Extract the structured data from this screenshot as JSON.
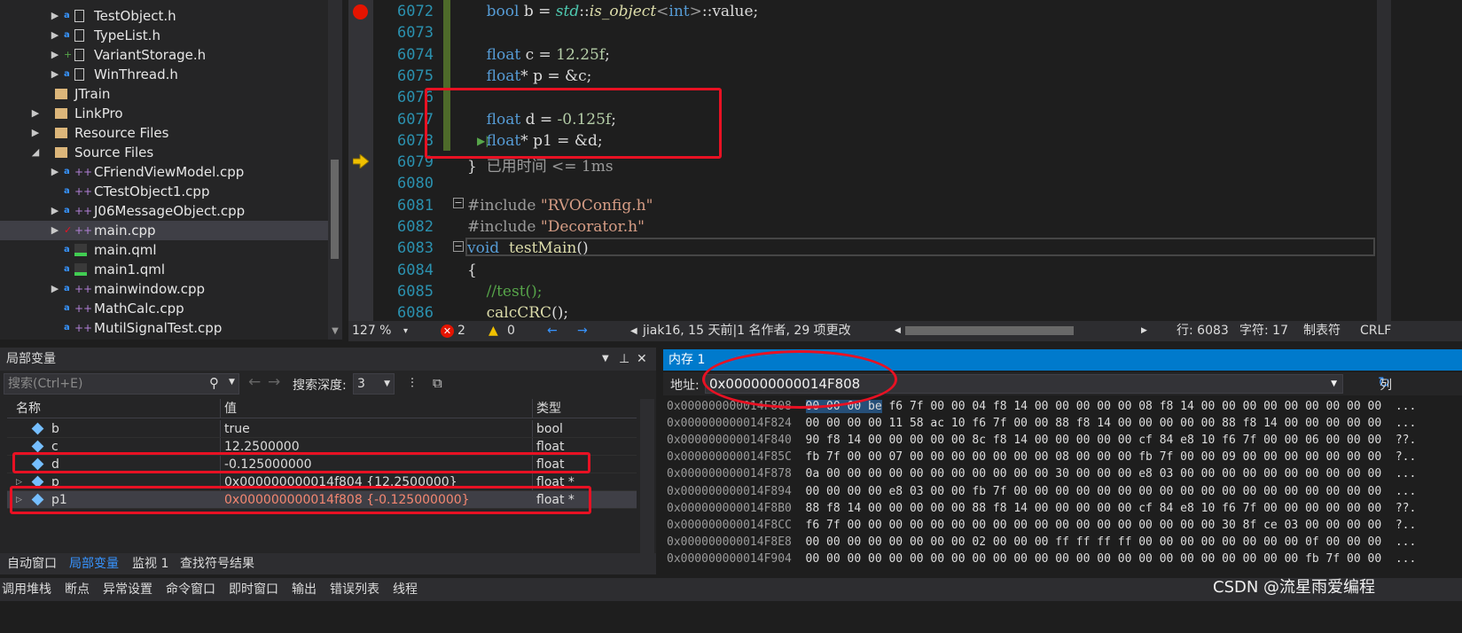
{
  "solution_explorer": {
    "items": [
      {
        "label": "TestObject.h",
        "exp": "▶",
        "status": "lock",
        "icon": "h-file-icon",
        "indent": 2
      },
      {
        "label": "TypeList.h",
        "exp": "▶",
        "status": "lock",
        "icon": "h-file-icon",
        "indent": 2
      },
      {
        "label": "VariantStorage.h",
        "exp": "▶",
        "status": "plus",
        "icon": "h-file-icon",
        "indent": 2
      },
      {
        "label": "WinThread.h",
        "exp": "▶",
        "status": "lock",
        "icon": "h-file-icon",
        "indent": 2
      },
      {
        "label": "JTrain",
        "exp": "",
        "status": "",
        "icon": "filter-folder-icon",
        "indent": 1
      },
      {
        "label": "LinkPro",
        "exp": "▶",
        "status": "",
        "icon": "filter-folder-icon",
        "indent": 1
      },
      {
        "label": "Resource Files",
        "exp": "▶",
        "status": "",
        "icon": "filter-folder-icon",
        "indent": 1
      },
      {
        "label": "Source Files",
        "exp": "◢",
        "status": "",
        "icon": "filter-folder-icon",
        "indent": 1
      },
      {
        "label": "CFriendViewModel.cpp",
        "exp": "▶",
        "status": "lock",
        "icon": "cpp-file-icon",
        "indent": 2
      },
      {
        "label": "CTestObject1.cpp",
        "exp": "",
        "status": "lock",
        "icon": "cpp-file-icon",
        "indent": 2
      },
      {
        "label": "J06MessageObject.cpp",
        "exp": "▶",
        "status": "lock",
        "icon": "cpp-file-icon",
        "indent": 2
      },
      {
        "label": "main.cpp",
        "exp": "▶",
        "status": "check",
        "icon": "cpp-file-icon",
        "indent": 2,
        "selected": true
      },
      {
        "label": "main.qml",
        "exp": "",
        "status": "lock",
        "icon": "qml-file-icon",
        "indent": 2
      },
      {
        "label": "main1.qml",
        "exp": "",
        "status": "lock",
        "icon": "qml-file-icon",
        "indent": 2
      },
      {
        "label": "mainwindow.cpp",
        "exp": "▶",
        "status": "lock",
        "icon": "cpp-file-icon",
        "indent": 2
      },
      {
        "label": "MathCalc.cpp",
        "exp": "",
        "status": "lock",
        "icon": "cpp-file-icon",
        "indent": 2
      },
      {
        "label": "MutilSignalTest.cpp",
        "exp": "",
        "status": "lock",
        "icon": "cpp-file-icon",
        "indent": 2
      }
    ]
  },
  "editor": {
    "lines": [
      {
        "n": "6072",
        "code": [
          [
            "id",
            "    "
          ],
          [
            "kw",
            "bool"
          ],
          [
            "id",
            " b = "
          ],
          [
            "ty it",
            "std"
          ],
          [
            "id",
            "::"
          ],
          [
            "fn it",
            "is_object"
          ],
          [
            "pp",
            "<"
          ],
          [
            "kw",
            "int"
          ],
          [
            "pp",
            ">"
          ],
          [
            "id",
            "::value;"
          ]
        ]
      },
      {
        "n": "6073",
        "code": []
      },
      {
        "n": "6074",
        "code": [
          [
            "id",
            "    "
          ],
          [
            "kw",
            "float"
          ],
          [
            "id",
            " c = "
          ],
          [
            "num",
            "12.25f"
          ],
          [
            "id",
            ";"
          ]
        ]
      },
      {
        "n": "6075",
        "code": [
          [
            "id",
            "    "
          ],
          [
            "kw",
            "float"
          ],
          [
            "id",
            "* p = &c;"
          ]
        ]
      },
      {
        "n": "6076",
        "code": []
      },
      {
        "n": "6077",
        "code": [
          [
            "id",
            "    "
          ],
          [
            "kw",
            "float"
          ],
          [
            "id",
            " d = "
          ],
          [
            "num",
            "-0.125f"
          ],
          [
            "id",
            ";"
          ]
        ]
      },
      {
        "n": "6078",
        "code": [
          [
            "id",
            "    "
          ],
          [
            "kw",
            "float"
          ],
          [
            "id",
            "* p1 = &d;"
          ]
        ]
      },
      {
        "n": "6079",
        "code": [
          [
            "id",
            "}"
          ],
          [
            "pp",
            "  已用时间 <= 1ms"
          ]
        ]
      },
      {
        "n": "6080",
        "code": []
      },
      {
        "n": "6081",
        "code": [
          [
            "pp",
            "#include "
          ],
          [
            "str",
            "\"RVOConfig.h\""
          ]
        ]
      },
      {
        "n": "6082",
        "code": [
          [
            "pp",
            "#include "
          ],
          [
            "str",
            "\"Decorator.h\""
          ]
        ]
      },
      {
        "n": "6083",
        "code": [
          [
            "kw",
            "void"
          ],
          [
            "id",
            "  "
          ],
          [
            "fn",
            "testMain"
          ],
          [
            "id",
            "()"
          ]
        ]
      },
      {
        "n": "6084",
        "code": [
          [
            "id",
            "{"
          ]
        ]
      },
      {
        "n": "6085",
        "code": [
          [
            "id",
            "    "
          ],
          [
            "cmt",
            "//test();"
          ]
        ]
      },
      {
        "n": "6086",
        "code": [
          [
            "id",
            "    "
          ],
          [
            "fn",
            "calcCRC"
          ],
          [
            "id",
            "();"
          ]
        ]
      }
    ],
    "status": {
      "zoom": "127 %",
      "errors": "2",
      "warnings": "0",
      "blame": "jiak16, 15 天前|1 名作者, 29 项更改",
      "line": "行: 6083",
      "char": "字符: 17",
      "tabs": "制表符",
      "eol": "CRLF"
    }
  },
  "locals": {
    "title": "局部变量",
    "search_placeholder": "搜索(Ctrl+E)",
    "depth_label": "搜索深度:",
    "depth_value": "3",
    "columns": [
      "名称",
      "值",
      "类型"
    ],
    "rows": [
      {
        "name": "b",
        "value": "true",
        "type": "bool",
        "expandable": false
      },
      {
        "name": "c",
        "value": "12.2500000",
        "type": "float",
        "expandable": false
      },
      {
        "name": "d",
        "value": "-0.125000000",
        "type": "float",
        "expandable": false
      },
      {
        "name": "p",
        "value": "0x000000000014f804 {12.2500000}",
        "type": "float *",
        "expandable": true
      },
      {
        "name": "p1",
        "value": "0x000000000014f808 {-0.125000000}",
        "type": "float *",
        "expandable": true,
        "selected": true
      }
    ],
    "tabs": [
      "自动窗口",
      "局部变量",
      "监视 1",
      "查找符号结果"
    ]
  },
  "bottom_tabs": [
    "调用堆栈",
    "断点",
    "异常设置",
    "命令窗口",
    "即时窗口",
    "输出",
    "错误列表",
    "线程"
  ],
  "memory": {
    "title": "内存 1",
    "addr_label": "地址:",
    "address": "0x000000000014F808",
    "col_label": "列",
    "rows": [
      {
        "addr": "0x000000000014F808",
        "bytes": "00 00 00 be f6 7f 00 00 04 f8 14 00 00 00 00 00 08 f8 14 00 00 00 00 00 00 00 00 00",
        "ascii": "..."
      },
      {
        "addr": "0x000000000014F824",
        "bytes": "00 00 00 00 11 58 ac 10 f6 7f 00 00 88 f8 14 00 00 00 00 00 88 f8 14 00 00 00 00 00",
        "ascii": "..."
      },
      {
        "addr": "0x000000000014F840",
        "bytes": "90 f8 14 00 00 00 00 00 8c f8 14 00 00 00 00 00 cf 84 e8 10 f6 7f 00 00 06 00 00 00",
        "ascii": "??."
      },
      {
        "addr": "0x000000000014F85C",
        "bytes": "fb 7f 00 00 07 00 00 00 00 00 00 00 08 00 00 00 fb 7f 00 00 09 00 00 00 00 00 00 00",
        "ascii": "?.."
      },
      {
        "addr": "0x000000000014F878",
        "bytes": "0a 00 00 00 00 00 00 00 00 00 00 00 30 00 00 00 e8 03 00 00 00 00 00 00 00 00 00 00",
        "ascii": "..."
      },
      {
        "addr": "0x000000000014F894",
        "bytes": "00 00 00 00 e8 03 00 00 fb 7f 00 00 00 00 00 00 00 00 00 00 00 00 00 00 00 00 00 00",
        "ascii": "..."
      },
      {
        "addr": "0x000000000014F8B0",
        "bytes": "88 f8 14 00 00 00 00 00 88 f8 14 00 00 00 00 00 cf 84 e8 10 f6 7f 00 00 00 00 00 00",
        "ascii": "??."
      },
      {
        "addr": "0x000000000014F8CC",
        "bytes": "f6 7f 00 00 00 00 00 00 00 00 00 00 00 00 00 00 00 00 00 00 30 8f ce 03 00 00 00 00",
        "ascii": "?.."
      },
      {
        "addr": "0x000000000014F8E8",
        "bytes": "00 00 00 00 00 00 00 00 02 00 00 00 ff ff ff ff 00 00 00 00 00 00 00 00 0f 00 00 00",
        "ascii": "..."
      },
      {
        "addr": "0x000000000014F904",
        "bytes": "00 00 00 00 00 00 00 00 00 00 00 00 00 00 00 00 00 00 00 00 00 00 00 00 fb 7f 00 00",
        "ascii": "..."
      }
    ]
  },
  "watermark": "CSDN @流星雨爱编程",
  "colors": {
    "highlight_red": "#e81123",
    "accent": "#007acc",
    "keyword": "#569cd6",
    "type": "#4ec9b0",
    "function": "#dcdcaa",
    "string": "#d69d85",
    "comment": "#57a64a"
  }
}
